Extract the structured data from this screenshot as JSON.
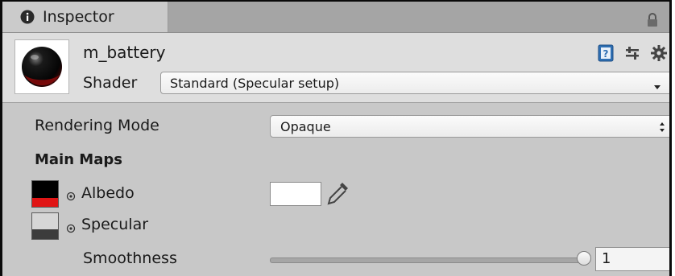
{
  "tab": {
    "title": "Inspector",
    "icon": "info-icon"
  },
  "header": {
    "material_name": "m_battery",
    "shader_label": "Shader",
    "shader_value": "Standard (Specular setup)",
    "icons": [
      "help-book-icon",
      "preset-settings-icon",
      "gear-icon"
    ]
  },
  "rendering_mode": {
    "label": "Rendering Mode",
    "value": "Opaque"
  },
  "main_maps": {
    "title": "Main Maps",
    "albedo": {
      "label": "Albedo",
      "color": "#ffffff"
    },
    "specular": {
      "label": "Specular"
    },
    "smoothness": {
      "label": "Smoothness",
      "value": "1",
      "fraction": 1.0
    }
  },
  "colors": {
    "panel_bg": "#c8c8c8",
    "header_bg": "#dedede",
    "albedo_texture": "#e01515"
  }
}
